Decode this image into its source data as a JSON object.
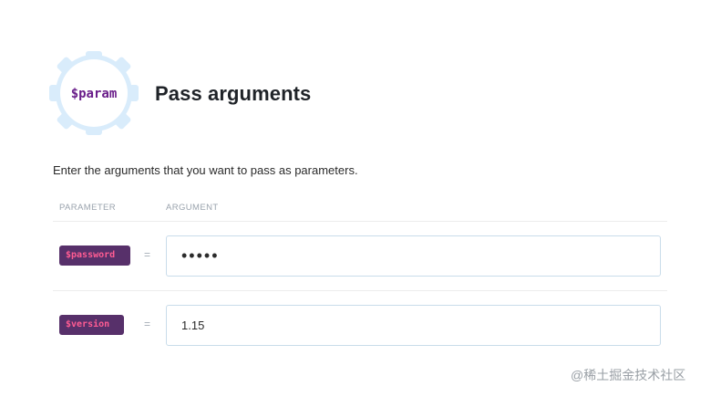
{
  "header": {
    "icon_label": "$param",
    "title": "Pass arguments"
  },
  "description": "Enter the arguments that you want to pass as parameters.",
  "table": {
    "headers": {
      "parameter": "PARAMETER",
      "argument": "ARGUMENT"
    },
    "equals_sign": "=",
    "rows": [
      {
        "parameter": "$password",
        "argument": "•••••",
        "input_type": "password"
      },
      {
        "parameter": "$version",
        "argument": "1.15",
        "input_type": "text"
      }
    ]
  },
  "colors": {
    "badge_bg": "#57306a",
    "badge_text": "#ff5c93",
    "gear_fill": "#d9ecfb",
    "icon_label": "#6a1e8a",
    "input_border": "#c9dcea"
  },
  "watermark": "@稀土掘金技术社区"
}
